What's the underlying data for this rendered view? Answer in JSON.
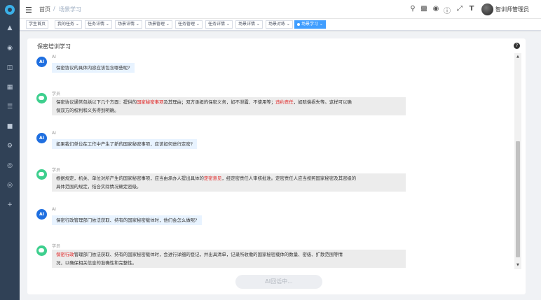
{
  "topbar": {
    "home": "首页",
    "separator": "/",
    "current": "场景学习",
    "username": "智训师管理员"
  },
  "tags": [
    {
      "label": "学生首页",
      "active": false
    },
    {
      "label": "我的任务",
      "active": false
    },
    {
      "label": "任务详情",
      "active": false
    },
    {
      "label": "场景详情",
      "active": false
    },
    {
      "label": "场景管理",
      "active": false
    },
    {
      "label": "任务管理",
      "active": false
    },
    {
      "label": "任务详情",
      "active": false
    },
    {
      "label": "场景详情",
      "active": false
    },
    {
      "label": "场景对练",
      "active": false
    },
    {
      "label": "场景学习",
      "active": true
    }
  ],
  "panel": {
    "title": "保密培训学习",
    "send_button": "AI回话中..."
  },
  "messages": [
    {
      "role": "ai",
      "name": "AI",
      "text": "保密协议的具体内容应该包含哪些呢?"
    },
    {
      "role": "student",
      "name": "学员",
      "line1_a": "保密协议通常包括以下几个方面：提供的",
      "line1_hl1": "国家秘密事项",
      "line1_b": "及其理由；双方承担的保密义务，如不泄露、不使用等；",
      "line1_hl2": "违约责任",
      "line1_c": "，如赔偿损失等。这样可以确",
      "line2": "保双方的权利和义务得到明确。"
    },
    {
      "role": "ai",
      "name": "AI",
      "text": "如果我们单位在工作中产生了新的国家秘密事项，应该如何进行定密?"
    },
    {
      "role": "student",
      "name": "学员",
      "line1_a": "根据规定，机关、单位对所产生的国家秘密事项，应当由承办人提出具体的",
      "line1_hl1": "定密意见",
      "line1_b": "，经定密责任人审核批准。定密责任人应当按照国家秘密及其密级的",
      "line2": "具体范围的规定，结合实际情况确定密级。"
    },
    {
      "role": "ai",
      "name": "AI",
      "text": "保密行政管理部门依法获取、持有的国家秘密载体时，他们会怎么做呢?"
    },
    {
      "role": "student",
      "name": "学员",
      "line1_hl1": "保密行政",
      "line1_a": "管理部门依法获取、持有的国家秘密载体时，会进行详细的登记，并出具清单，记录所收缴的国家秘密载体的数量、密级、扩散范围等情",
      "line2": "况，以确保相关信息的准确性和完整性。"
    }
  ]
}
